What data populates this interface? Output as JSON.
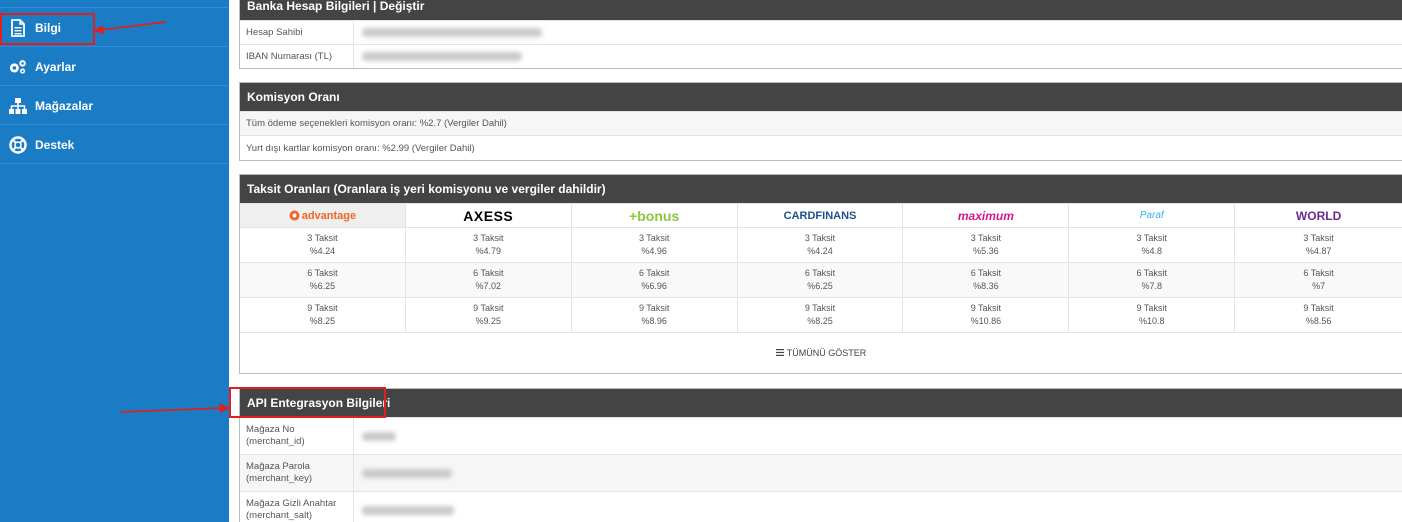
{
  "sidebar": {
    "items": [
      {
        "label": "Bilgi",
        "icon": "document-icon"
      },
      {
        "label": "Ayarlar",
        "icon": "gears-icon"
      },
      {
        "label": "Mağazalar",
        "icon": "sitemap-icon"
      },
      {
        "label": "Destek",
        "icon": "lifebuoy-icon"
      }
    ]
  },
  "bank": {
    "title": "Banka Hesap Bilgileri | Değiştir",
    "rows": [
      {
        "label": "Hesap Sahibi"
      },
      {
        "label": "IBAN Numarası (TL)"
      }
    ]
  },
  "commission": {
    "title": "Komisyon Oranı",
    "lines": [
      "Tüm ödeme seçenekleri komisyon oranı: %2.7 (Vergiler Dahil)",
      "Yurt dışı kartlar komisyon oranı: %2.99 (Vergiler Dahil)"
    ]
  },
  "installments": {
    "title": "Taksit Oranları (Oranlara iş yeri komisyonu ve vergiler dahildir)",
    "cards": [
      {
        "name": "advantage",
        "color": "#f26522",
        "rates": [
          {
            "taksit": "3 Taksit",
            "rate": "%4.24"
          },
          {
            "taksit": "6 Taksit",
            "rate": "%6.25"
          },
          {
            "taksit": "9 Taksit",
            "rate": "%8.25"
          }
        ]
      },
      {
        "name": "AXESS",
        "color": "#000000",
        "rates": [
          {
            "taksit": "3 Taksit",
            "rate": "%4.79"
          },
          {
            "taksit": "6 Taksit",
            "rate": "%7.02"
          },
          {
            "taksit": "9 Taksit",
            "rate": "%9.25"
          }
        ]
      },
      {
        "name": "+bonus",
        "color": "#8cc63f",
        "rates": [
          {
            "taksit": "3 Taksit",
            "rate": "%4.96"
          },
          {
            "taksit": "6 Taksit",
            "rate": "%6.96"
          },
          {
            "taksit": "9 Taksit",
            "rate": "%8.96"
          }
        ]
      },
      {
        "name": "CARDFINANS",
        "color": "#1d4f91",
        "rates": [
          {
            "taksit": "3 Taksit",
            "rate": "%4.24"
          },
          {
            "taksit": "6 Taksit",
            "rate": "%6.25"
          },
          {
            "taksit": "9 Taksit",
            "rate": "%8.25"
          }
        ]
      },
      {
        "name": "maximum",
        "color": "#d6168b",
        "rates": [
          {
            "taksit": "3 Taksit",
            "rate": "%5.36"
          },
          {
            "taksit": "6 Taksit",
            "rate": "%8.36"
          },
          {
            "taksit": "9 Taksit",
            "rate": "%10.86"
          }
        ]
      },
      {
        "name": "Paraf",
        "color": "#3ab0e2",
        "rates": [
          {
            "taksit": "3 Taksit",
            "rate": "%4.8"
          },
          {
            "taksit": "6 Taksit",
            "rate": "%7.8"
          },
          {
            "taksit": "9 Taksit",
            "rate": "%10.8"
          }
        ]
      },
      {
        "name": "WORLD",
        "color": "#6b2c91",
        "rates": [
          {
            "taksit": "3 Taksit",
            "rate": "%4.87"
          },
          {
            "taksit": "6 Taksit",
            "rate": "%7"
          },
          {
            "taksit": "9 Taksit",
            "rate": "%8.56"
          }
        ]
      }
    ],
    "show_all": "TÜMÜNÜ GÖSTER"
  },
  "api": {
    "title": "API Entegrasyon Bilgileri",
    "rows": [
      {
        "label1": "Mağaza No",
        "label2": "(merchant_id)"
      },
      {
        "label1": "Mağaza Parola",
        "label2": "(merchant_key)"
      },
      {
        "label1": "Mağaza Gizli Anahtar",
        "label2": "(merchant_salt)"
      }
    ]
  },
  "colors": {
    "sidebar": "#1a7cc4",
    "header": "#444444",
    "annotation": "#e02020"
  }
}
